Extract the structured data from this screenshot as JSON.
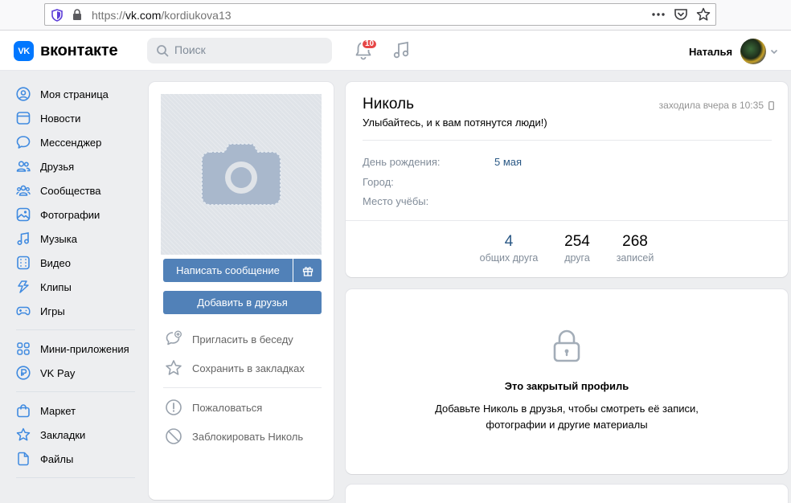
{
  "browser": {
    "url_prefix": "https://",
    "url_domain": "vk.com",
    "url_path": "/kordiukova13"
  },
  "header": {
    "logo_text": "вконтакте",
    "logo_mark": "VK",
    "search_placeholder": "Поиск",
    "notifications_count": "10",
    "user_name": "Наталья"
  },
  "menu": {
    "group1": [
      {
        "label": "Моя страница",
        "icon": "user-circle-icon"
      },
      {
        "label": "Новости",
        "icon": "newsfeed-icon"
      },
      {
        "label": "Мессенджер",
        "icon": "message-icon"
      },
      {
        "label": "Друзья",
        "icon": "friends-icon"
      },
      {
        "label": "Сообщества",
        "icon": "communities-icon"
      },
      {
        "label": "Фотографии",
        "icon": "photo-icon"
      },
      {
        "label": "Музыка",
        "icon": "music-icon"
      },
      {
        "label": "Видео",
        "icon": "video-icon"
      },
      {
        "label": "Клипы",
        "icon": "clips-icon"
      },
      {
        "label": "Игры",
        "icon": "gamepad-icon"
      }
    ],
    "group2": [
      {
        "label": "Мини-приложения",
        "icon": "apps-icon"
      },
      {
        "label": "VK Pay",
        "icon": "vkpay-icon"
      }
    ],
    "group3": [
      {
        "label": "Маркет",
        "icon": "market-icon"
      },
      {
        "label": "Закладки",
        "icon": "bookmark-star-icon"
      },
      {
        "label": "Файлы",
        "icon": "file-icon"
      }
    ]
  },
  "profile_actions": {
    "message_button": "Написать сообщение",
    "add_friend_button": "Добавить в друзья",
    "invite_chat": "Пригласить в беседу",
    "save_bookmarks": "Сохранить в закладках",
    "report": "Пожаловаться",
    "block": "Заблокировать Николь"
  },
  "profile": {
    "name": "Николь",
    "last_seen": "заходила вчера в 10:35",
    "status": "Улыбайтесь, и к вам потянутся люди!)",
    "fields": [
      {
        "label": "День рождения:",
        "value": "5 мая"
      },
      {
        "label": "Город:",
        "value": ""
      },
      {
        "label": "Место учёбы:",
        "value": ""
      }
    ],
    "counters": [
      {
        "value": "4",
        "label": "общих друга"
      },
      {
        "value": "254",
        "label": "друга"
      },
      {
        "value": "268",
        "label": "записей"
      }
    ]
  },
  "private": {
    "title": "Это закрытый профиль",
    "desc_line1": "Добавьте Николь в друзья, чтобы смотреть её записи,",
    "desc_line2": "фотографии и другие материалы"
  },
  "colors": {
    "accent": "#5181b8",
    "link": "#2a5885",
    "vk_blue": "#0077ff",
    "badge": "#e64646",
    "icon": "#3f8ae0"
  }
}
